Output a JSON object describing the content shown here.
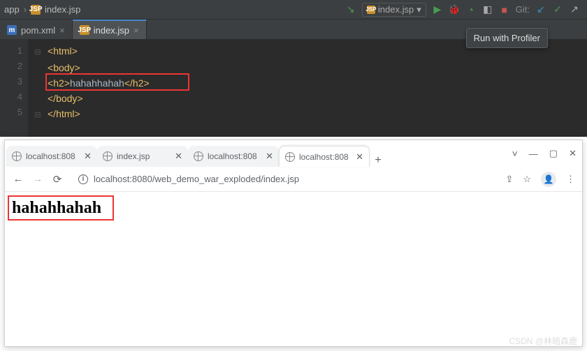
{
  "ide": {
    "breadcrumb": {
      "folder": "app",
      "file": "index.jsp"
    },
    "toolbar": {
      "runConfig": "index.jsp",
      "gitLabel": "Git:"
    },
    "tooltip": "Run with Profiler",
    "tabs": [
      {
        "icon": "pom",
        "iconText": "m",
        "label": "pom.xml"
      },
      {
        "icon": "jsp",
        "iconText": "JSP",
        "label": "index.jsp"
      }
    ],
    "code": {
      "lines": [
        "1",
        "2",
        "3",
        "4",
        "5"
      ],
      "l1_open": "<",
      "l1_tag": "html",
      "l1_close": ">",
      "l2_open": "<",
      "l2_tag": "body",
      "l2_close": ">",
      "l3_open": "<",
      "l3_tag": "h2",
      "l3_close": ">",
      "l3_text": "hahahhahah",
      "l3_eopen": "</",
      "l3_etag": "h2",
      "l3_eclose": ">",
      "l4_open": "</",
      "l4_tag": "body",
      "l4_close": ">",
      "l5_open": "</",
      "l5_tag": "html",
      "l5_close": ">"
    }
  },
  "chrome": {
    "tabs": [
      {
        "title": "localhost:808",
        "close": "✕"
      },
      {
        "title": "index.jsp",
        "close": "✕"
      },
      {
        "title": "localhost:808",
        "close": "✕"
      },
      {
        "title": "localhost:808",
        "close": "✕"
      }
    ],
    "url": "localhost:8080/web_demo_war_exploded/index.jsp",
    "page_h2": "hahahhahah"
  },
  "watermark": "CSDN @林暗森鹿"
}
